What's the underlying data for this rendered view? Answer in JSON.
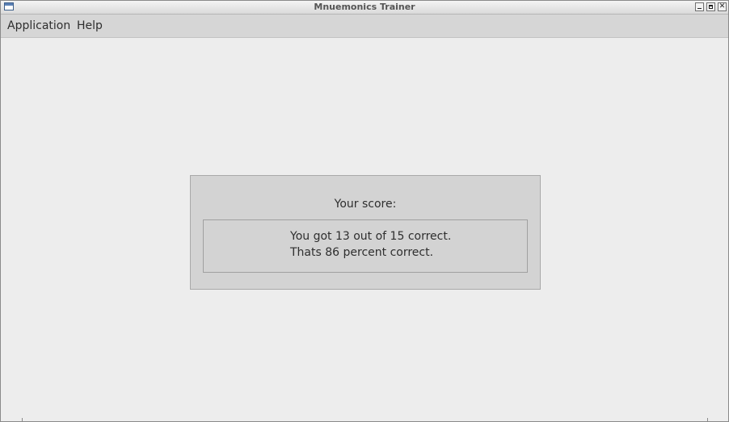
{
  "window": {
    "title": "Mnuemonics Trainer",
    "icon": "app-window-icon",
    "controls": [
      "minimize-icon",
      "maximize-icon",
      "close-icon"
    ]
  },
  "menubar": {
    "items": [
      {
        "label": "Application"
      },
      {
        "label": "Help"
      }
    ]
  },
  "score": {
    "heading": "Your score:",
    "line1": "You got 13 out of 15 correct.",
    "line2": "Thats 86 percent correct.",
    "correct": 13,
    "total": 15,
    "percent": 86
  },
  "colors": {
    "background": "#ededed",
    "menubar": "#d6d6d6",
    "panel": "#d3d3d3",
    "text": "#2e2e2e"
  }
}
